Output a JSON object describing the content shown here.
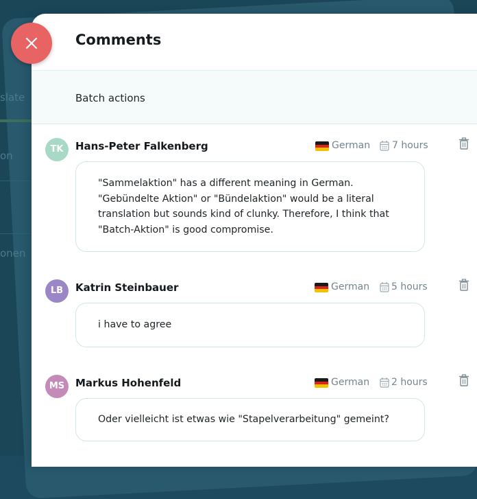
{
  "panel": {
    "title": "Comments",
    "batch_actions_label": "Batch actions"
  },
  "background": {
    "partial_texts": [
      "slate",
      "on",
      "onen"
    ]
  },
  "comments": [
    {
      "initials": "TK",
      "avatar_color": "#a8d8c6",
      "author": "Hans-Peter Falkenberg",
      "language": "German",
      "time": "7 hours",
      "text": "\"Sammelaktion\" has a different meaning in German. \"Gebündelte Aktion\" or \"Bündelaktion\" would be a literal translation but sounds kind of clunky. Therefore, I think that \"Batch-Aktion\" is good compromise."
    },
    {
      "initials": "LB",
      "avatar_color": "#9b86c6",
      "author": "Katrin Steinbauer",
      "language": "German",
      "time": "5 hours",
      "text": "i have to agree"
    },
    {
      "initials": "MS",
      "avatar_color": "#c48bb8",
      "author": "Markus Hohenfeld",
      "language": "German",
      "time": "2 hours",
      "text": "Oder vielleicht ist etwas wie \"Stapelverarbeitung\" gemeint?"
    }
  ],
  "icons": {
    "close": "close-icon",
    "flag": "german-flag-icon",
    "calendar": "calendar-icon",
    "delete": "trash-icon"
  },
  "colors": {
    "close_button": "#e86363",
    "meta_text": "#73858e",
    "bubble_border": "#d3e6ea"
  }
}
